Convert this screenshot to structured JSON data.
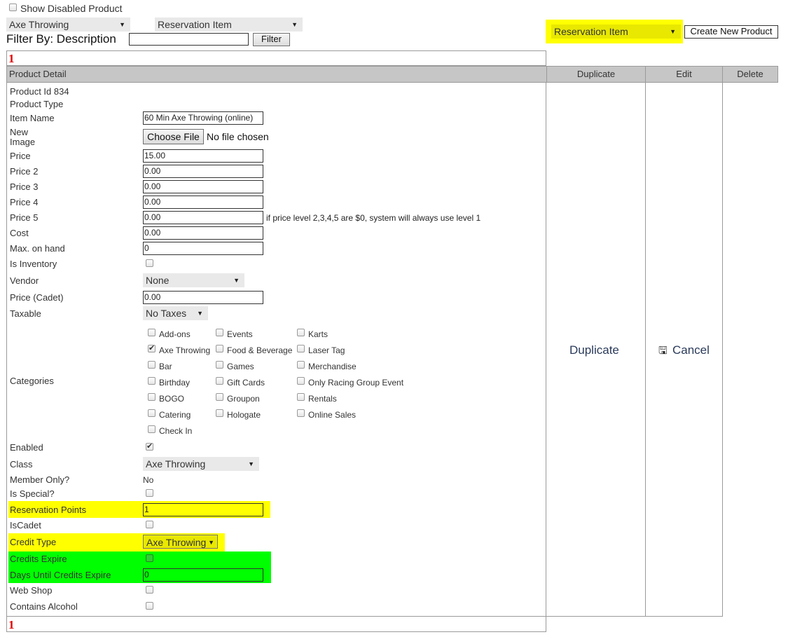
{
  "top": {
    "show_disabled_label": "Show Disabled Product",
    "select_class": "Axe Throwing",
    "select_type": "Reservation Item",
    "filter_by_label": "Filter By: Description",
    "filter_button": "Filter",
    "select_type_right": "Reservation Item",
    "create_button": "Create New Product"
  },
  "pager": {
    "page": "1"
  },
  "table": {
    "headers": [
      "Product Detail",
      "Duplicate",
      "Edit",
      "Delete"
    ],
    "duplicate_link": "Duplicate",
    "cancel_link": "Cancel"
  },
  "form": {
    "product_id": "Product Id 834",
    "product_type_label": "Product Type",
    "item_name_label": "Item Name",
    "item_name_value": "60 Min Axe Throwing (online)",
    "new_image_label_1": "New",
    "new_image_label_2": "Image",
    "choose_file": "Choose File",
    "no_file": "No file chosen",
    "price_label": "Price",
    "price_value": "15.00",
    "price2_label": "Price 2",
    "price2_value": "0.00",
    "price3_label": "Price 3",
    "price3_value": "0.00",
    "price4_label": "Price 4",
    "price4_value": "0.00",
    "price5_label": "Price 5",
    "price5_value": "0.00",
    "price_note": "if price level 2,3,4,5 are $0, system will always use level 1",
    "cost_label": "Cost",
    "cost_value": "0.00",
    "max_label": "Max. on hand",
    "max_value": "0",
    "inventory_label": "Is Inventory",
    "vendor_label": "Vendor",
    "vendor_value": "None",
    "cadet_price_label": "Price (Cadet)",
    "cadet_price_value": "0.00",
    "taxable_label": "Taxable",
    "taxable_value": "No Taxes",
    "categories_label": "Categories",
    "categories": [
      "Add-ons",
      "Axe Throwing",
      "Bar",
      "Birthday",
      "BOGO",
      "Catering",
      "Check In",
      "Events",
      "Food & Beverage",
      "Games",
      "Gift Cards",
      "Groupon",
      "Hologate",
      "Karts",
      "Laser Tag",
      "Merchandise",
      "Only Racing Group Event",
      "Rentals",
      "Online Sales"
    ],
    "enabled_label": "Enabled",
    "class_label": "Class",
    "class_value": "Axe Throwing",
    "member_label": "Member Only?",
    "member_value": "No",
    "special_label": "Is Special?",
    "res_points_label": "Reservation Points",
    "res_points_value": "1",
    "iscadet_label": "IsCadet",
    "credit_type_label": "Credit Type",
    "credit_type_value": "Axe Throwing",
    "credits_expire_label": "Credits Expire",
    "days_label": "Days Until Credits Expire",
    "days_value": "0",
    "webshop_label": "Web Shop",
    "alcohol_label": "Contains Alcohol"
  },
  "colors": {
    "highlight_yellow": "#ffff00",
    "highlight_green": "#00ff00",
    "header_gray": "#c6c6c6",
    "pager_red": "#e00000"
  }
}
